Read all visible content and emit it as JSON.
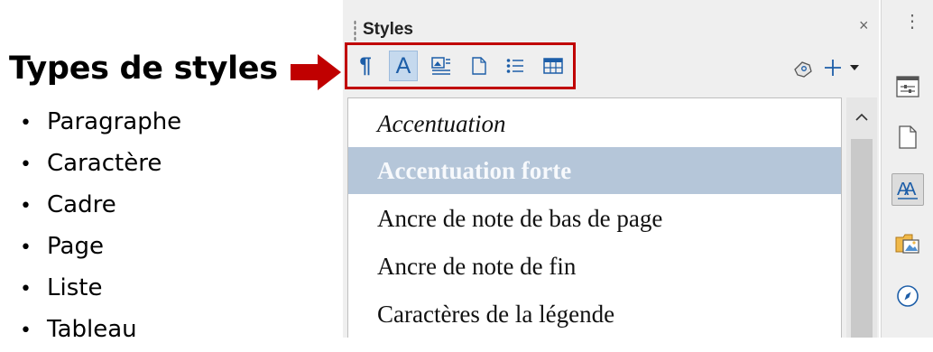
{
  "annotation": {
    "title": "Types de styles",
    "arrow_color": "#c00000",
    "items": [
      "Paragraphe",
      "Caractère",
      "Cadre",
      "Page",
      "Liste",
      "Tableau"
    ]
  },
  "panel": {
    "title": "Styles",
    "close_glyph": "×",
    "type_buttons": [
      {
        "name": "paragraph-styles-icon",
        "glyph": "¶",
        "active": false
      },
      {
        "name": "character-styles-icon",
        "glyph": "A",
        "active": true
      },
      {
        "name": "frame-styles-icon",
        "active": false
      },
      {
        "name": "page-styles-icon",
        "active": false
      },
      {
        "name": "list-styles-icon",
        "active": false
      },
      {
        "name": "table-styles-icon",
        "active": false
      }
    ],
    "styles": [
      {
        "label": "Accentuation",
        "italic": true,
        "selected": false
      },
      {
        "label": "Accentuation forte",
        "italic": false,
        "selected": true
      },
      {
        "label": "Ancre de note de bas de page",
        "italic": false,
        "selected": false
      },
      {
        "label": "Ancre de note de fin",
        "italic": false,
        "selected": false
      },
      {
        "label": "Caractères de la légende",
        "italic": false,
        "selected": false
      }
    ]
  },
  "sidebar": {
    "menu_glyph": "⋮",
    "buttons": [
      "properties-icon",
      "page-icon",
      "styles-icon",
      "gallery-icon",
      "navigator-icon"
    ],
    "active": "styles-icon"
  },
  "colors": {
    "accent": "#1d5ea8",
    "highlight": "#c00000",
    "selection": "#b5c6d9"
  }
}
